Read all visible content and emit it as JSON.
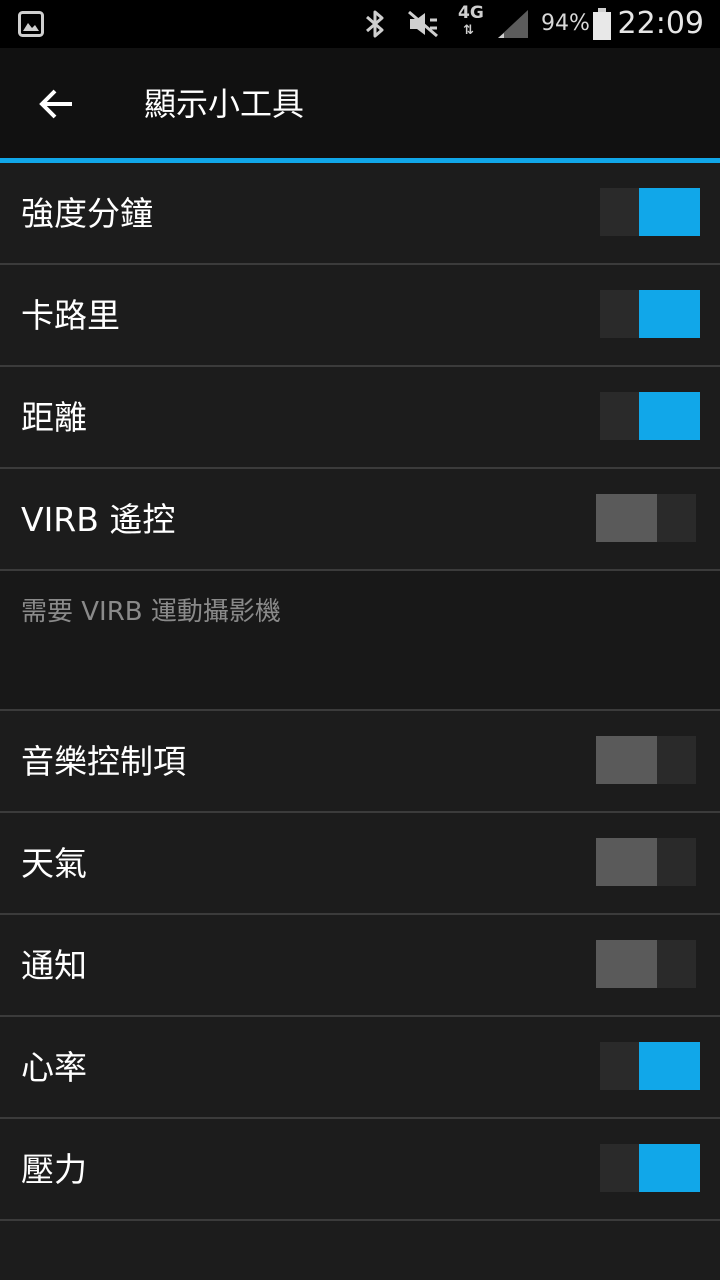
{
  "status_bar": {
    "network_type": "4G",
    "network_arrows": "⇅",
    "battery": "94%",
    "time": "22:09",
    "icons": [
      "gallery-icon",
      "bluetooth-icon",
      "mute-icon",
      "signal-icon",
      "battery-icon"
    ]
  },
  "app_bar": {
    "title": "顯示小工具",
    "back_icon": "arrow-left-icon"
  },
  "colors": {
    "accent": "#11a7e9",
    "background": "#1c1c1c",
    "toggle_off_knob": "#5a5a5a"
  },
  "widgets": [
    {
      "label": "強度分鐘",
      "enabled": true
    },
    {
      "label": "卡路里",
      "enabled": true
    },
    {
      "label": "距離",
      "enabled": true
    },
    {
      "label": "VIRB 遙控",
      "enabled": false
    },
    {
      "label": "音樂控制項",
      "enabled": false
    },
    {
      "label": "天氣",
      "enabled": false
    },
    {
      "label": "通知",
      "enabled": false
    },
    {
      "label": "心率",
      "enabled": true
    },
    {
      "label": "壓力",
      "enabled": true
    }
  ],
  "virb_note": "需要 VIRB 運動攝影機"
}
